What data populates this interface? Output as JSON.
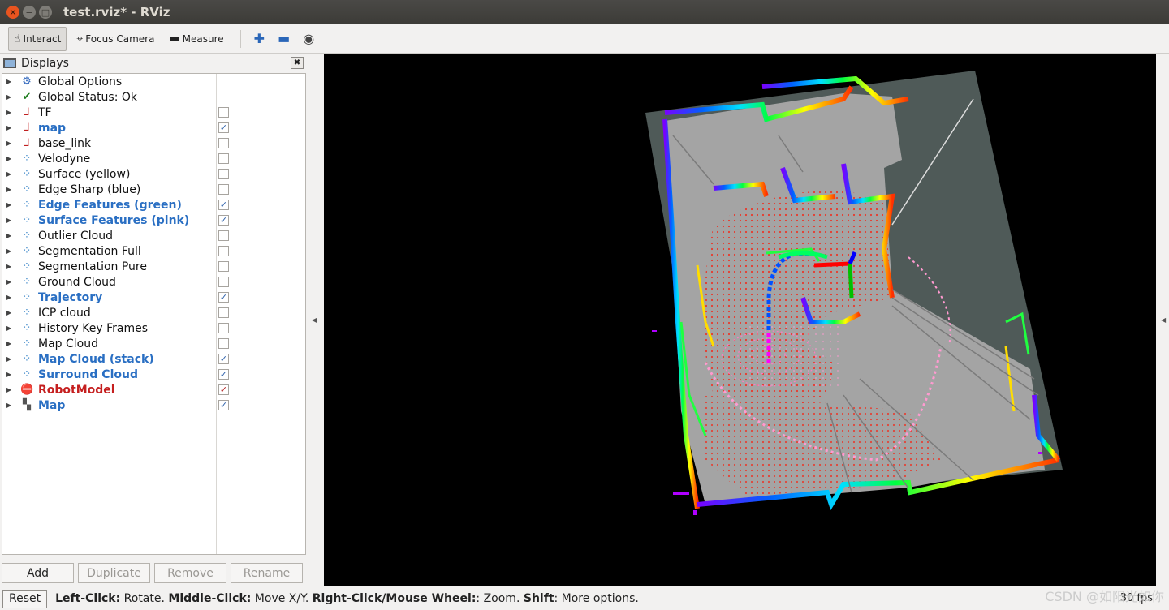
{
  "window": {
    "title": "test.rviz* - RViz"
  },
  "toolbar": {
    "interact": "Interact",
    "focus_camera": "Focus Camera",
    "measure": "Measure"
  },
  "displays": {
    "title": "Displays",
    "items": [
      {
        "label": "Global Options",
        "icon": "gear-icon",
        "checked": null,
        "style": "normal"
      },
      {
        "label": "Global Status: Ok",
        "icon": "check-icon",
        "checked": null,
        "style": "normal"
      },
      {
        "label": "TF",
        "icon": "axes-icon",
        "checked": false,
        "style": "normal"
      },
      {
        "label": "map",
        "icon": "axes-icon",
        "checked": true,
        "style": "enabled"
      },
      {
        "label": "base_link",
        "icon": "axes-icon",
        "checked": false,
        "style": "normal"
      },
      {
        "label": "Velodyne",
        "icon": "pointcloud-icon",
        "checked": false,
        "style": "normal"
      },
      {
        "label": "Surface (yellow)",
        "icon": "pointcloud-icon",
        "checked": false,
        "style": "normal"
      },
      {
        "label": "Edge Sharp (blue)",
        "icon": "pointcloud-icon",
        "checked": false,
        "style": "normal"
      },
      {
        "label": "Edge Features (green)",
        "icon": "pointcloud-icon",
        "checked": true,
        "style": "enabled"
      },
      {
        "label": "Surface Features (pink)",
        "icon": "pointcloud-icon",
        "checked": true,
        "style": "enabled"
      },
      {
        "label": "Outlier Cloud",
        "icon": "pointcloud-icon",
        "checked": false,
        "style": "normal"
      },
      {
        "label": "Segmentation Full",
        "icon": "pointcloud-icon",
        "checked": false,
        "style": "normal"
      },
      {
        "label": "Segmentation Pure",
        "icon": "pointcloud-icon",
        "checked": false,
        "style": "normal"
      },
      {
        "label": "Ground Cloud",
        "icon": "pointcloud-icon",
        "checked": false,
        "style": "normal"
      },
      {
        "label": "Trajectory",
        "icon": "pointcloud-icon",
        "checked": true,
        "style": "enabled"
      },
      {
        "label": "ICP cloud",
        "icon": "pointcloud-icon",
        "checked": false,
        "style": "normal"
      },
      {
        "label": "History Key Frames",
        "icon": "pointcloud-icon",
        "checked": false,
        "style": "normal"
      },
      {
        "label": "Map Cloud",
        "icon": "pointcloud-icon",
        "checked": false,
        "style": "normal"
      },
      {
        "label": "Map Cloud (stack)",
        "icon": "pointcloud-icon",
        "checked": true,
        "style": "enabled"
      },
      {
        "label": "Surround Cloud",
        "icon": "pointcloud-icon",
        "checked": true,
        "style": "enabled"
      },
      {
        "label": "RobotModel",
        "icon": "error-icon",
        "checked": true,
        "style": "error"
      },
      {
        "label": "Map",
        "icon": "grid-map-icon",
        "checked": true,
        "style": "enabled"
      }
    ],
    "buttons": {
      "add": "Add",
      "duplicate": "Duplicate",
      "remove": "Remove",
      "rename": "Rename"
    }
  },
  "status": {
    "reset": "Reset",
    "left_click_key": "Left-Click:",
    "left_click_val": " Rotate. ",
    "middle_click_key": "Middle-Click:",
    "middle_click_val": " Move X/Y. ",
    "right_click_key": "Right-Click/Mouse Wheel:",
    "right_click_val": ": Zoom. ",
    "shift_key": "Shift",
    "shift_val": ": More options.",
    "fps": "30 fps"
  },
  "watermark": "CSDN @如阳光如你",
  "colors": {
    "enabled_text": "#2a6fc3",
    "error_text": "#c51f1f",
    "viewport_bg": "#000000",
    "map_gray": "#a9a9a9"
  }
}
